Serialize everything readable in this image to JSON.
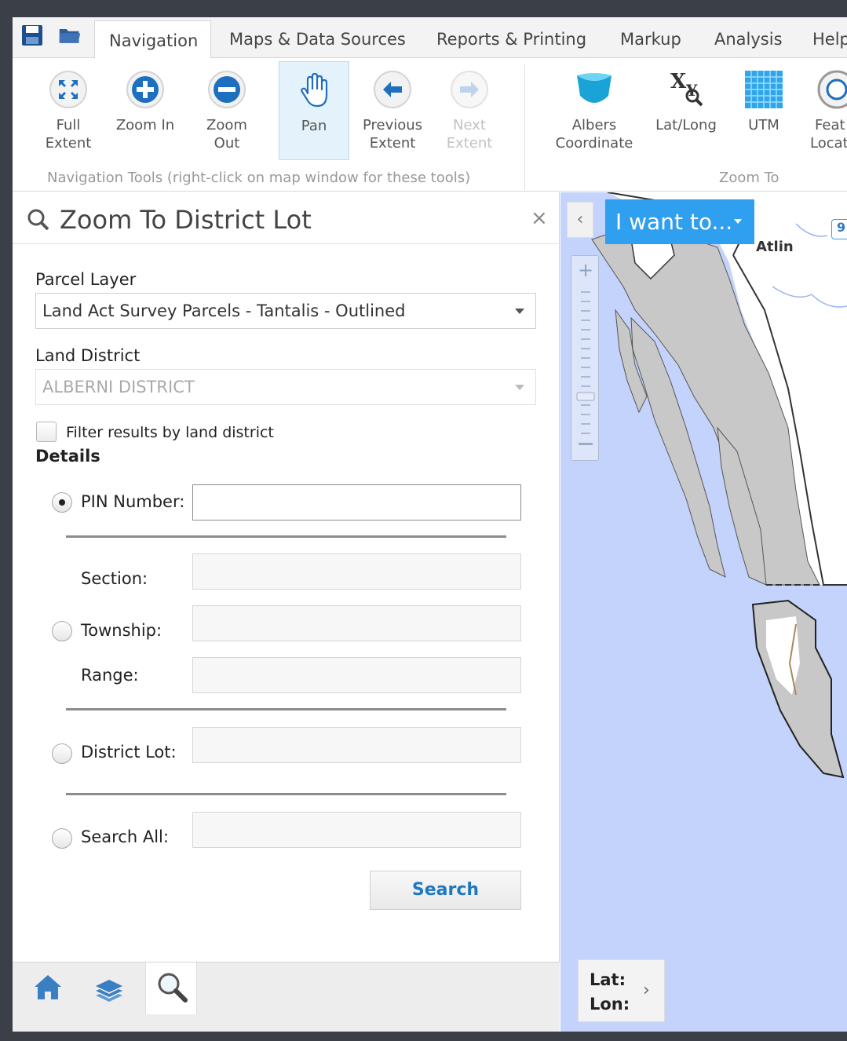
{
  "tabs": [
    {
      "label": "Navigation"
    },
    {
      "label": "Maps & Data Sources"
    },
    {
      "label": "Reports & Printing"
    },
    {
      "label": "Markup"
    },
    {
      "label": "Analysis"
    },
    {
      "label": "Help"
    }
  ],
  "navigation_tools": {
    "full_extent": {
      "line1": "Full",
      "line2": "Extent"
    },
    "zoom_in": {
      "line1": "Zoom In"
    },
    "zoom_out": {
      "line1": "Zoom Out"
    },
    "pan": {
      "line1": "Pan"
    },
    "previous_extent": {
      "line1": "Previous",
      "line2": "Extent"
    },
    "next_extent": {
      "line1": "Next",
      "line2": "Extent"
    },
    "group_label": "Navigation Tools (right-click on map window for these tools)"
  },
  "zoom_to_tools": {
    "albers": {
      "line1": "Albers",
      "line2": "Coordinate"
    },
    "latlong": {
      "line1": "Lat/Long"
    },
    "utm": {
      "line1": "UTM"
    },
    "feature": {
      "line1": "Feat",
      "line2": "Locat"
    },
    "group_label": "Zoom To"
  },
  "panel": {
    "title": "Zoom To District Lot",
    "close": "×",
    "parcel_layer_label": "Parcel Layer",
    "parcel_layer_value": "Land Act Survey Parcels - Tantalis - Outlined",
    "land_district_label": "Land District",
    "land_district_value": "ALBERNI DISTRICT",
    "filter_label": "Filter results by land district",
    "details_label": "Details",
    "pin_label": "PIN Number:",
    "section_label": "Section:",
    "township_label": "Township:",
    "range_label": "Range:",
    "district_lot_label": "District Lot:",
    "search_all_label": "Search All:",
    "search_button": "Search"
  },
  "map": {
    "i_want_to": "I want to...",
    "collapse": "‹",
    "place_label": "Atlin",
    "lat_label": "Lat:",
    "lon_label": "Lon:",
    "expand": "›",
    "badge": "9"
  },
  "colors": {
    "accent": "#2f9ff0",
    "water": "#c3d3fb",
    "land": "#c8c8c8",
    "link": "#1e78c2"
  }
}
